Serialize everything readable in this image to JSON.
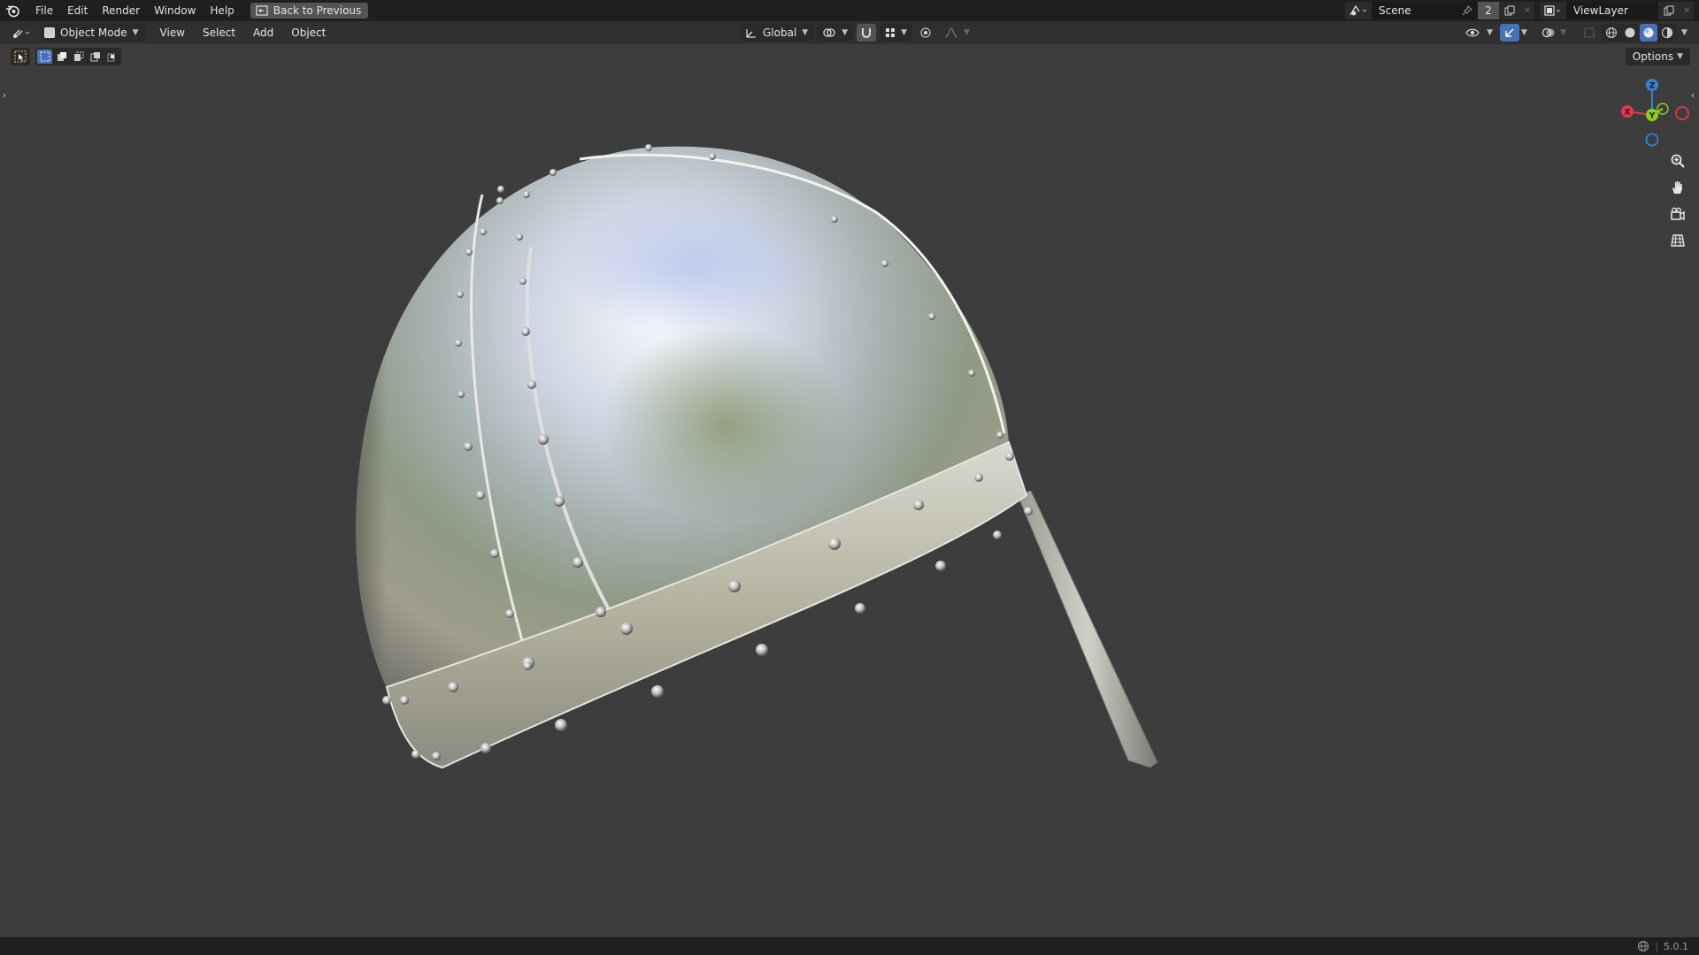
{
  "topbar": {
    "menus": [
      "File",
      "Edit",
      "Render",
      "Window",
      "Help"
    ],
    "back_label": "Back to Previous",
    "scene_name": "Scene",
    "scene_count": "2",
    "view_layer": "ViewLayer"
  },
  "header": {
    "mode": "Object Mode",
    "menus": [
      "View",
      "Select",
      "Add",
      "Object"
    ],
    "transform_orientation": "Global",
    "options_label": "Options"
  },
  "status": {
    "version": "5.0.1"
  },
  "gizmo": {
    "x_label": "X",
    "y_label": "Y",
    "z_label": "Z",
    "x_color": "#e2394c",
    "y_color": "#8ccf18",
    "z_color": "#3b7fd6"
  },
  "colors": {
    "viewport_bg": "#3d3d3d",
    "accent": "#4772b3",
    "topbar_bg": "#1f1f1f",
    "header_bg": "#303030"
  },
  "icons": {
    "app": "blender-logo-icon",
    "back": "back-to-previous-icon",
    "shading_modes": [
      "wireframe-icon",
      "solid-icon",
      "material-preview-icon",
      "rendered-icon"
    ],
    "nav": [
      "zoom-icon",
      "pan-hand-icon",
      "camera-view-icon",
      "ortho-grid-icon"
    ]
  }
}
